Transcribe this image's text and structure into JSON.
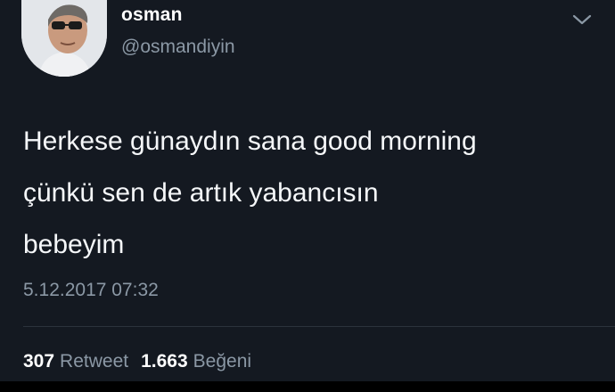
{
  "tweet": {
    "display_name": "osman",
    "handle": "@osmandiyin",
    "text": "Herkese günaydın sana good morning\nçünkü sen de artık yabancısın\nbebeyim",
    "timestamp": "5.12.2017 07:32",
    "retweets": "307",
    "retweets_label": "Retweet",
    "likes": "1.663",
    "likes_label": "Beğeni",
    "menu_icon": "chevron-down-icon",
    "avatar_icon": "avatar-photo"
  },
  "colors": {
    "background": "#141921",
    "text": "#f5f7f9",
    "muted": "#8b98a5"
  }
}
